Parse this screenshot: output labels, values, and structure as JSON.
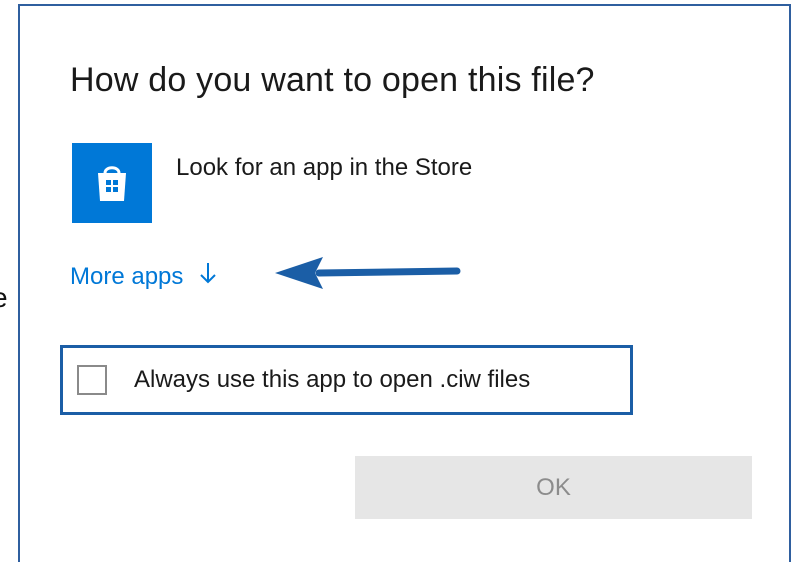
{
  "background": {
    "fragment_text": "e"
  },
  "dialog": {
    "title": "How do you want to open this file?",
    "store_option": {
      "label": "Look for an app in the Store",
      "icon": "store-bag-icon",
      "tile_color": "#0078d7"
    },
    "more_apps": {
      "label": "More apps",
      "icon": "arrow-down-icon",
      "color": "#0078d7"
    },
    "annotation": {
      "icon": "pointer-arrow-left-icon",
      "color": "#1b5ea6"
    },
    "always_use_checkbox": {
      "label": "Always use this app to open .ciw files",
      "checked": false
    },
    "ok_button": {
      "label": "OK",
      "enabled": false
    },
    "border_color": "#2f5f9f"
  }
}
